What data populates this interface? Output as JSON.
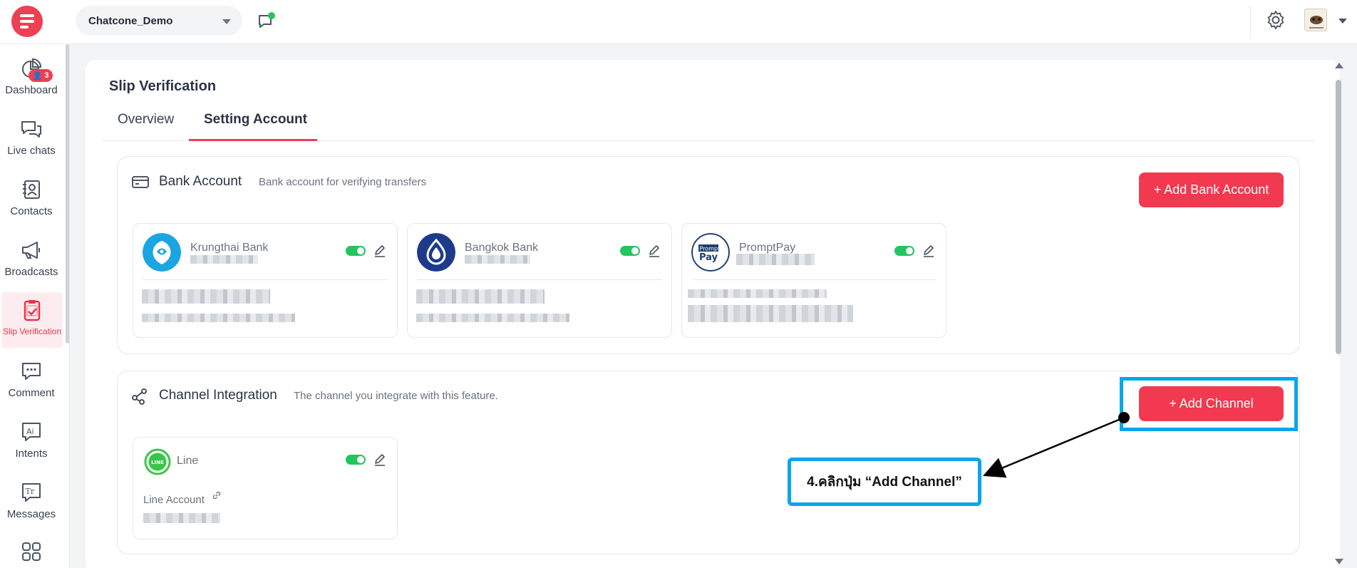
{
  "header": {
    "workspace": "Chatcone_Demo"
  },
  "sidebar": {
    "items": [
      {
        "label": "Dashboard",
        "icon": "dashboard-icon"
      },
      {
        "label": "Live chats",
        "icon": "live-chats-icon",
        "badge": "3"
      },
      {
        "label": "Contacts",
        "icon": "contacts-icon"
      },
      {
        "label": "Broadcasts",
        "icon": "broadcast-icon"
      },
      {
        "label": "Slip Verification",
        "icon": "slip-verification-icon",
        "active": true
      },
      {
        "label": "Comment",
        "icon": "comment-icon"
      },
      {
        "label": "Intents",
        "icon": "intents-icon"
      },
      {
        "label": "Messages",
        "icon": "messages-icon"
      },
      {
        "label": "",
        "icon": "apps-grid-icon"
      }
    ]
  },
  "page": {
    "title": "Slip Verification",
    "tabs": [
      {
        "label": "Overview",
        "active": false
      },
      {
        "label": "Setting Account",
        "active": true
      }
    ]
  },
  "bank_section": {
    "title": "Bank Account",
    "subtitle": "Bank account for verifying transfers",
    "add_button": "+ Add Bank Account",
    "accounts": [
      {
        "name": "Krungthai Bank",
        "enabled": true,
        "color": "#1ba5e1"
      },
      {
        "name": "Bangkok Bank",
        "enabled": true,
        "color": "#1e3a8a"
      },
      {
        "name": "PromptPay",
        "enabled": true,
        "color": "#1c3f6e"
      }
    ]
  },
  "channel_section": {
    "title": "Channel Integration",
    "subtitle": "The channel you integrate with this feature.",
    "add_button": "+ Add Channel",
    "channels": [
      {
        "name": "Line",
        "account_label": "Line Account",
        "enabled": true,
        "color": "#3ac549",
        "logo_text": "LINE"
      }
    ]
  },
  "annotation": {
    "callout": "4.คลิกปุ่ม “Add Channel”"
  },
  "colors": {
    "brand": "#ef3f53",
    "toggle_on": "#22c55e",
    "annotation": "#08a6ea"
  }
}
